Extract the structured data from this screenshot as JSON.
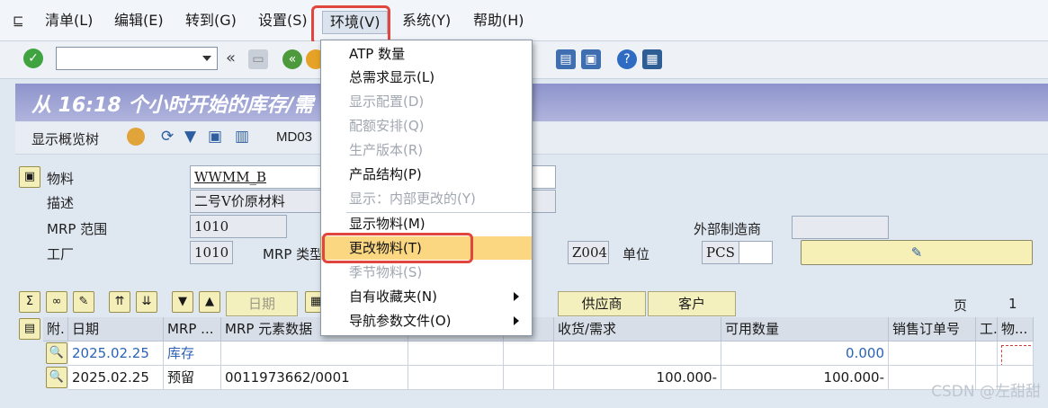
{
  "menubar": {
    "items": [
      {
        "label": "清单(L)"
      },
      {
        "label": "编辑(E)"
      },
      {
        "label": "转到(G)"
      },
      {
        "label": "设置(S)"
      },
      {
        "label": "环境(V)"
      },
      {
        "label": "系统(Y)"
      },
      {
        "label": "帮助(H)"
      }
    ]
  },
  "toolbar": {
    "command_value": "",
    "back_symbol": "«"
  },
  "title": "从 16:18 个小时开始的库存/需",
  "app_toolbar": {
    "overview_label": "显示概览树",
    "tcode_label": "MD03"
  },
  "header": {
    "material_label": "物料",
    "material_value": "WWMM_B",
    "desc_label": "描述",
    "desc_value": "二号V价原材料",
    "mrp_area_label": "MRP 范围",
    "mrp_area_value": "1010",
    "plant_label": "工厂",
    "plant_value": "1010",
    "mrp_type_label": "MRP 类型",
    "mrp_type_value": "Z004",
    "unit_label": "单位",
    "unit_value": "PCS",
    "ext_proc_label": "外部制造商"
  },
  "tabs": {
    "date_label": "日期",
    "vendor_label": "供应商",
    "customer_label": "客户"
  },
  "page": {
    "label": "页",
    "value": "1"
  },
  "grid": {
    "headers": {
      "att": "附.",
      "date": "日期",
      "mrp": "MRP ...",
      "element_data": "MRP 元素数据",
      "receipt": "收货/需求",
      "available": "可用数量",
      "so": "销售订单号",
      "g": "工.",
      "item": "物..."
    },
    "rows": [
      {
        "date": "2025.02.25",
        "mrp": "库存",
        "element_data": "",
        "receipt": "",
        "available": "0.000"
      },
      {
        "date": "2025.02.25",
        "mrp": "预留",
        "element_data": "0011973662/0001",
        "receipt": "100.000-",
        "available": "100.000-"
      }
    ]
  },
  "dropdown": {
    "items": [
      {
        "label": "ATP 数量",
        "state": "enabled"
      },
      {
        "label": "总需求显示(L)",
        "state": "enabled"
      },
      {
        "label": "显示配置(D)",
        "state": "disabled"
      },
      {
        "label": "配额安排(Q)",
        "state": "disabled"
      },
      {
        "label": "生产版本(R)",
        "state": "disabled"
      },
      {
        "label": "产品结构(P)",
        "state": "enabled"
      },
      {
        "label": "显示：内部更改的(Y)",
        "state": "disabled"
      },
      {
        "label": "显示物料(M)",
        "state": "enabled"
      },
      {
        "label": "更改物料(T)",
        "state": "highlighted"
      },
      {
        "label": "季节物料(S)",
        "state": "disabled"
      },
      {
        "label": "自有收藏夹(N)",
        "state": "submenu"
      },
      {
        "label": "导航参数文件(O)",
        "state": "submenu"
      }
    ]
  },
  "watermark": "CSDN @左甜甜",
  "colors": {
    "highlight": "#fbd782",
    "annotation_red": "#e0463e",
    "title_bg": "#8e94cc"
  }
}
